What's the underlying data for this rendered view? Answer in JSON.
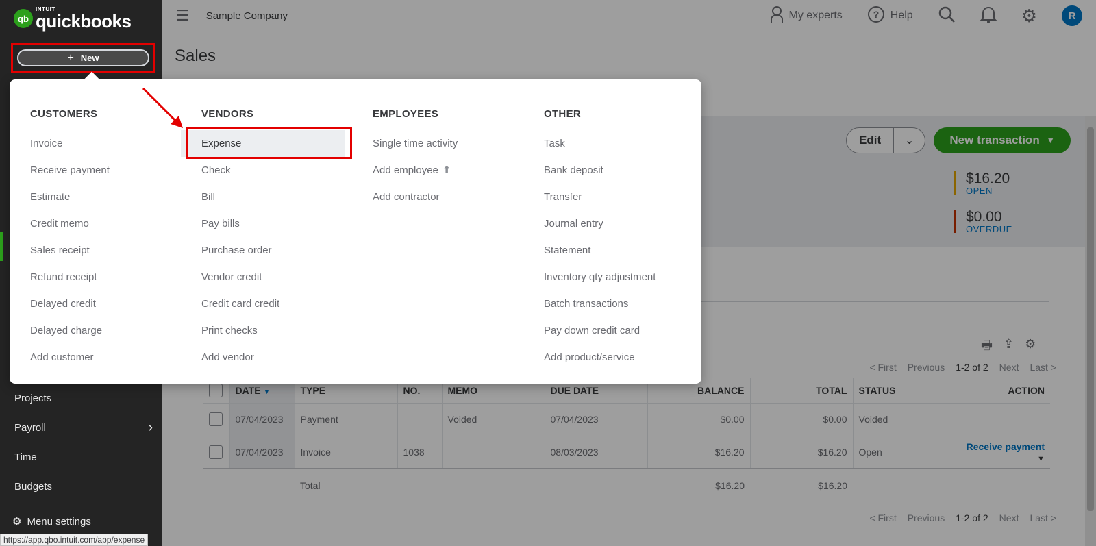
{
  "logo": {
    "mark": "qb",
    "intuit": "INTUIT",
    "name": "quickbooks"
  },
  "sidebar": {
    "new_label": "New",
    "items": [
      {
        "label": "Projects"
      },
      {
        "label": "Payroll"
      },
      {
        "label": "Time"
      },
      {
        "label": "Budgets"
      }
    ],
    "settings_label": "Menu settings"
  },
  "topbar": {
    "company": "Sample Company",
    "experts": "My experts",
    "help": "Help",
    "avatar": "R"
  },
  "page": {
    "title": "Sales"
  },
  "actions": {
    "edit": "Edit",
    "new_transaction": "New transaction"
  },
  "stats": [
    {
      "amount": "$16.20",
      "label": "OPEN",
      "color": "#e0a400"
    },
    {
      "amount": "$0.00",
      "label": "OVERDUE",
      "color": "#c23000"
    }
  ],
  "pager": {
    "first": "< First",
    "previous": "Previous",
    "count": "1-2 of 2",
    "next": "Next",
    "last": "Last >"
  },
  "table": {
    "headers": [
      "DATE",
      "TYPE",
      "NO.",
      "MEMO",
      "DUE DATE",
      "BALANCE",
      "TOTAL",
      "STATUS",
      "ACTION"
    ],
    "rows": [
      {
        "date": "07/04/2023",
        "type": "Payment",
        "no": "",
        "memo": "Voided",
        "due": "07/04/2023",
        "balance": "$0.00",
        "total": "$0.00",
        "status": "Voided",
        "action": ""
      },
      {
        "date": "07/04/2023",
        "type": "Invoice",
        "no": "1038",
        "memo": "",
        "due": "08/03/2023",
        "balance": "$16.20",
        "total": "$16.20",
        "status": "Open",
        "action": "Receive payment"
      }
    ],
    "total_row": {
      "label": "Total",
      "balance": "$16.20",
      "total": "$16.20"
    }
  },
  "menu": {
    "columns": [
      {
        "heading": "CUSTOMERS",
        "items": [
          "Invoice",
          "Receive payment",
          "Estimate",
          "Credit memo",
          "Sales receipt",
          "Refund receipt",
          "Delayed credit",
          "Delayed charge",
          "Add customer"
        ]
      },
      {
        "heading": "VENDORS",
        "items": [
          "Expense",
          "Check",
          "Bill",
          "Pay bills",
          "Purchase order",
          "Vendor credit",
          "Credit card credit",
          "Print checks",
          "Add vendor"
        ]
      },
      {
        "heading": "EMPLOYEES",
        "items": [
          "Single time activity",
          "Add employee",
          "Add contractor"
        ]
      },
      {
        "heading": "OTHER",
        "items": [
          "Task",
          "Bank deposit",
          "Transfer",
          "Journal entry",
          "Statement",
          "Inventory qty adjustment",
          "Batch transactions",
          "Pay down credit card",
          "Add product/service"
        ]
      }
    ]
  },
  "status_bar": {
    "url": "https://app.qbo.intuit.com/app/expense"
  },
  "colors": {
    "brand_green": "#2ca01c",
    "link_blue": "#0077c5",
    "highlight_red": "#e30000"
  }
}
